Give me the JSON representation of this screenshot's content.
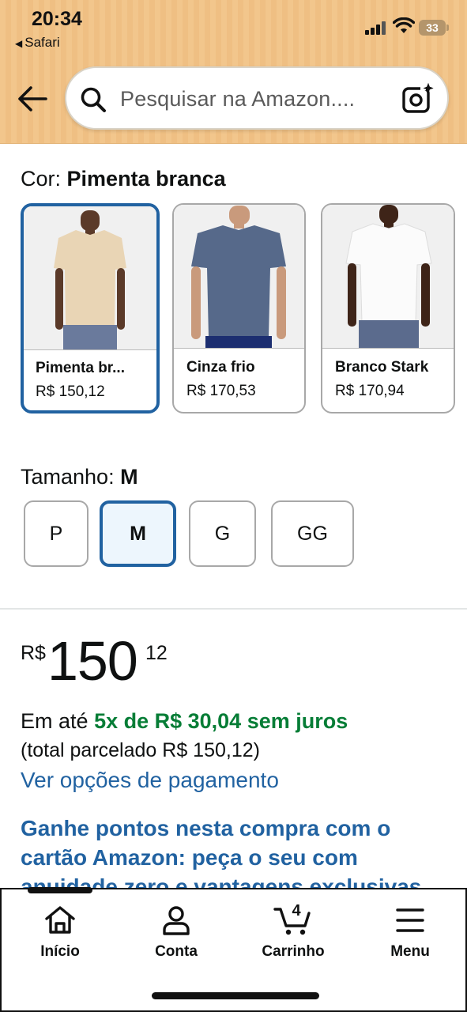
{
  "status_bar": {
    "time": "20:34",
    "back_app": "Safari",
    "battery": "33"
  },
  "search": {
    "placeholder": "Pesquisar na Amazon...."
  },
  "color": {
    "label": "Cor:",
    "selected": "Pimenta branca",
    "options": [
      {
        "name": "Pimenta br...",
        "price": "R$ 150,12",
        "shirt_color": "#e9d5b5",
        "selected": true
      },
      {
        "name": "Cinza frio",
        "price": "R$ 170,53",
        "shirt_color": "#56698a",
        "selected": false
      },
      {
        "name": "Branco Stark",
        "price": "R$ 170,94",
        "shirt_color": "#f7f7f7",
        "selected": false
      }
    ]
  },
  "size": {
    "label": "Tamanho:",
    "selected": "M",
    "options": [
      "P",
      "M",
      "G",
      "GG"
    ]
  },
  "price": {
    "currency": "R$",
    "whole": "150",
    "cents": "12"
  },
  "installments": {
    "prefix": "Em até",
    "highlight": "5x de R$ 30,04 sem juros",
    "total": "(total parcelado R$ 150,12)",
    "link": "Ver opções de pagamento"
  },
  "promo": {
    "text": "Ganhe pontos nesta compra com o cartão Amazon: peça o seu com anuidade zero e vantagens exclusivas"
  },
  "bottom_nav": {
    "items": [
      {
        "label": "Início",
        "icon": "home-icon"
      },
      {
        "label": "Conta",
        "icon": "account-icon"
      },
      {
        "label": "Carrinho",
        "icon": "cart-icon"
      },
      {
        "label": "Menu",
        "icon": "menu-icon"
      }
    ],
    "cart_count": "4"
  },
  "colors": {
    "link_blue": "#2162a1",
    "deal_green": "#067d36",
    "header_bg": "#f2c68c"
  }
}
